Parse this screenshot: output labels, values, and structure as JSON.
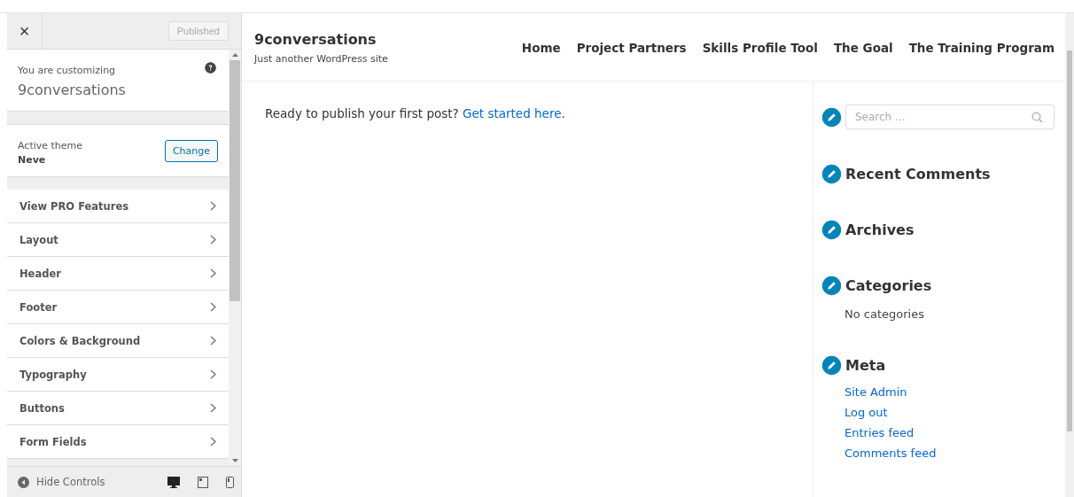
{
  "customizer": {
    "close": "×",
    "publish_button": {
      "label": "Published",
      "disabled": true
    },
    "info": {
      "label": "You are customizing",
      "site": "9conversations"
    },
    "theme": {
      "label": "Active theme",
      "name": "Neve",
      "button": "Change"
    },
    "sections": [
      {
        "label": "View PRO Features"
      },
      {
        "label": "Layout"
      },
      {
        "label": "Header"
      },
      {
        "label": "Footer"
      },
      {
        "label": "Colors & Background"
      },
      {
        "label": "Typography"
      },
      {
        "label": "Buttons"
      },
      {
        "label": "Form Fields"
      }
    ],
    "footer": {
      "hide_label": "Hide Controls",
      "devices": [
        {
          "kind": "desktop",
          "selected": true
        },
        {
          "kind": "tablet",
          "selected": false
        },
        {
          "kind": "mobile",
          "selected": false
        }
      ]
    }
  },
  "preview": {
    "site_title": "9conversations",
    "tagline": "Just another WordPress site",
    "nav": [
      "Home",
      "Project Partners",
      "Skills Profile Tool",
      "The Goal",
      "The Training Program"
    ],
    "post": {
      "text": "Ready to publish your first post?",
      "link": "Get started here",
      "after": "."
    },
    "search": {
      "placeholder": "Search ..."
    },
    "widgets": [
      {
        "title": "Recent Comments"
      },
      {
        "title": "Archives"
      },
      {
        "title": "Categories",
        "text": "No categories"
      },
      {
        "title": "Meta",
        "items": [
          "Site Admin",
          "Log out",
          "Entries feed",
          "Comments feed"
        ]
      }
    ]
  }
}
